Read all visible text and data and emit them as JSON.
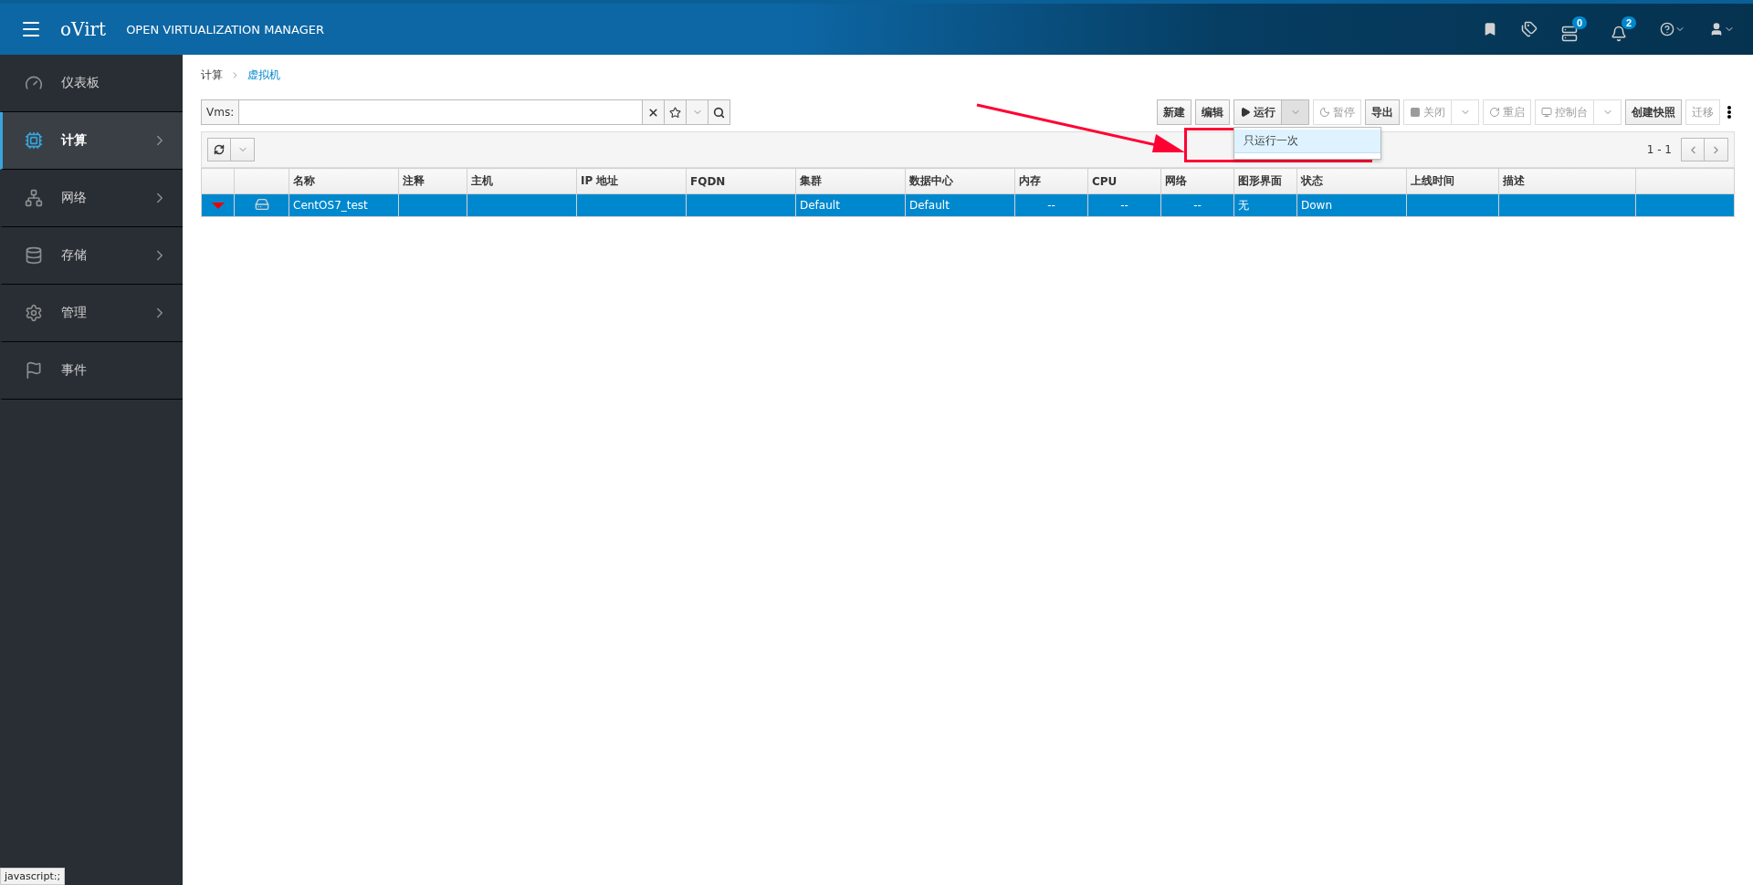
{
  "header": {
    "brand": "oVirt",
    "title": "OPEN VIRTUALIZATION MANAGER",
    "badges": [
      {
        "kind": "tasks",
        "count": "0"
      },
      {
        "kind": "events",
        "count": "2"
      }
    ]
  },
  "sidebar": {
    "items": [
      {
        "label": "仪表板",
        "selected": false,
        "expandable": false
      },
      {
        "label": "计算",
        "selected": true,
        "expandable": true
      },
      {
        "label": "网络",
        "selected": false,
        "expandable": true
      },
      {
        "label": "存储",
        "selected": false,
        "expandable": true
      },
      {
        "label": "管理",
        "selected": false,
        "expandable": true
      },
      {
        "label": "事件",
        "selected": false,
        "expandable": false
      }
    ]
  },
  "breadcrumb": [
    "计算",
    "虚拟机"
  ],
  "search": {
    "label": "Vms:"
  },
  "toolbar": [
    {
      "label": "新建",
      "disabled": false,
      "split": false
    },
    {
      "label": "编辑",
      "disabled": false,
      "split": false
    },
    {
      "label": "运行",
      "disabled": false,
      "split": true
    },
    {
      "label": "暂停",
      "disabled": true,
      "split": false
    },
    {
      "label": "导出",
      "disabled": false,
      "split": false
    },
    {
      "label": "关闭",
      "disabled": true,
      "split": true
    },
    {
      "label": "重启",
      "disabled": true,
      "split": false
    },
    {
      "label": "控制台",
      "disabled": true,
      "split": true
    },
    {
      "label": "创建快照",
      "disabled": false,
      "split": false
    },
    {
      "label": "迁移",
      "disabled": true,
      "split": false
    }
  ],
  "run_menu": {
    "items": [
      {
        "label": "只运行一次",
        "selected": true
      }
    ]
  },
  "pagination": "1 - 1",
  "table": {
    "columns": [
      "名称",
      "注释",
      "主机",
      "IP 地址",
      "FQDN",
      "集群",
      "数据中心",
      "内存",
      "CPU",
      "网络",
      "图形界面",
      "状态",
      "上线时间",
      "描述"
    ],
    "rows": [
      {
        "selected": true,
        "cells": [
          "CentOS7_test",
          "",
          "",
          "",
          "",
          "Default",
          "Default",
          "--",
          "--",
          "--",
          "无",
          "Down",
          "",
          ""
        ]
      }
    ]
  },
  "status_text": "javascript:;"
}
